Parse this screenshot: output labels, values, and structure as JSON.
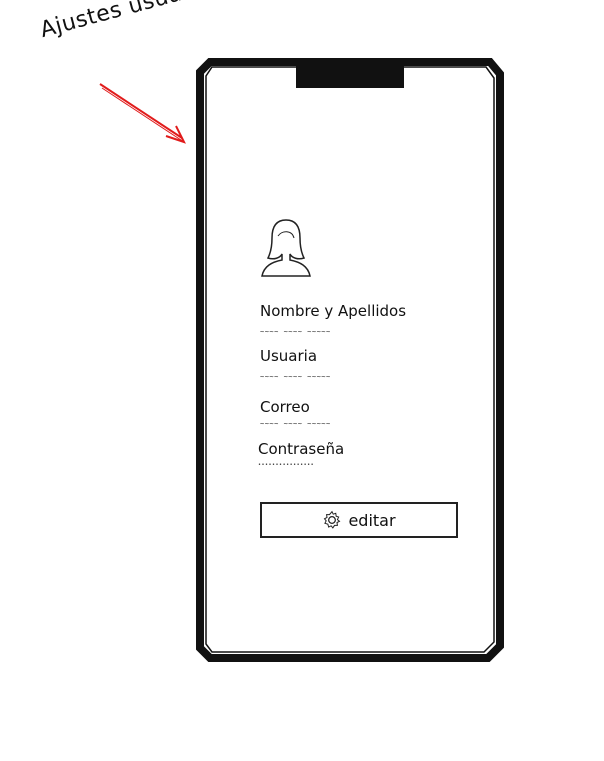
{
  "annotation": {
    "text": "Ajustes usuario",
    "arrow_color": "#e11b1b"
  },
  "profile": {
    "avatar_icon": "user-avatar-icon",
    "fields": [
      {
        "label": "Nombre y Apellidos",
        "value": "~~~~ ~~~~ ~~~~~"
      },
      {
        "label": "Usuaria",
        "value": "~~~~ ~~~~ ~~~~~"
      },
      {
        "label": "Correo",
        "value": "~~~~ ~~~~ ~~~~~"
      },
      {
        "label": "Contraseña",
        "value": "••••••••••••••••"
      }
    ]
  },
  "actions": {
    "edit_label": "editar",
    "edit_icon": "gear-icon"
  }
}
